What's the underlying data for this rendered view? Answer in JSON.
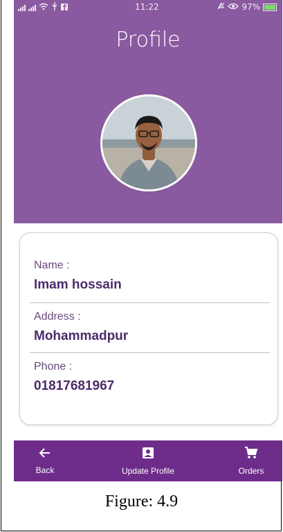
{
  "statusbar": {
    "time": "11:22",
    "battery_text": "97%"
  },
  "header": {
    "title": "Profile"
  },
  "profile": {
    "name_label": "Name :",
    "name_value": "Imam hossain",
    "address_label": "Address :",
    "address_value": "Mohammadpur",
    "phone_label": "Phone :",
    "phone_value": "01817681967"
  },
  "nav": {
    "back_label": "Back",
    "update_label": "Update Profile",
    "orders_label": "Orders"
  },
  "colors": {
    "header_purple": "#8a5aa0",
    "nav_purple": "#6e2c8a",
    "text_purple": "#4b2b6a"
  },
  "caption": "Figure: 4.9"
}
